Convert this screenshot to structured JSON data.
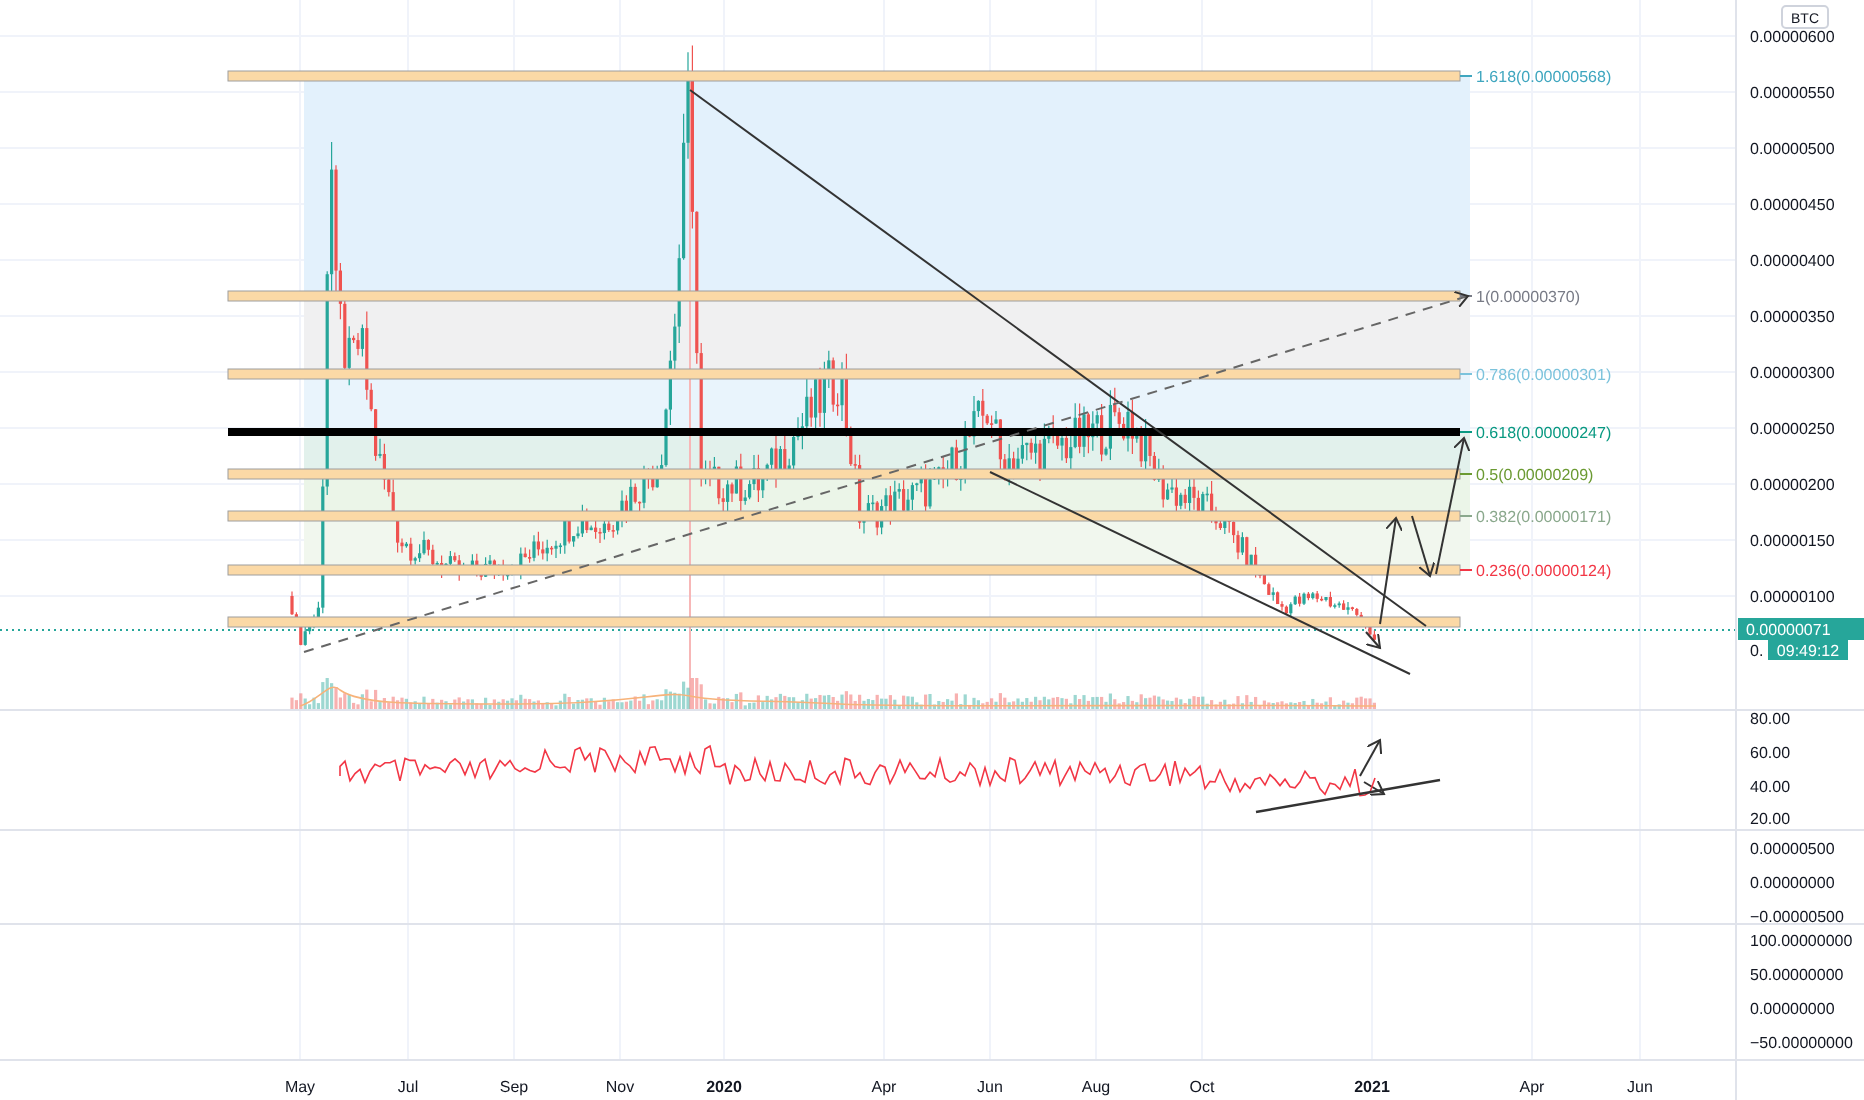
{
  "price_axis": {
    "unit": "BTC",
    "ticks": [
      "0.00000600",
      "0.00000550",
      "0.00000500",
      "0.00000450",
      "0.00000400",
      "0.00000350",
      "0.00000300",
      "0.00000250",
      "0.00000200",
      "0.00000150",
      "0.00000100",
      "0."
    ]
  },
  "last_price": {
    "value": "0.00000071",
    "countdown": "09:49:12"
  },
  "fib_levels": [
    {
      "label": "1.618(0.00000568)",
      "color": "#3fa6bf"
    },
    {
      "label": "1(0.00000370)",
      "color": "#787b86"
    },
    {
      "label": "0.786(0.00000301)",
      "color": "#7cc3dc"
    },
    {
      "label": "0.618(0.00000247)",
      "color": "#089981"
    },
    {
      "label": "0.5(0.00000209)",
      "color": "#6b9a32"
    },
    {
      "label": "0.382(0.00000171)",
      "color": "#8aa88c"
    },
    {
      "label": "0.236(0.00000124)",
      "color": "#f23645"
    }
  ],
  "rsi_axis": {
    "ticks": [
      "80.00",
      "60.00",
      "40.00",
      "20.00"
    ]
  },
  "pane_3_axis": {
    "ticks": [
      "0.00000500",
      "0.00000000",
      "−0.00000500"
    ]
  },
  "pane_4_axis": {
    "ticks": [
      "100.00000000",
      "50.00000000",
      "0.00000000",
      "−50.00000000"
    ]
  },
  "time_axis": [
    {
      "label": "May",
      "kind": "month"
    },
    {
      "label": "Jul",
      "kind": "month"
    },
    {
      "label": "Sep",
      "kind": "month"
    },
    {
      "label": "Nov",
      "kind": "month"
    },
    {
      "label": "2020",
      "kind": "year"
    },
    {
      "label": "Apr",
      "kind": "month"
    },
    {
      "label": "Jun",
      "kind": "month"
    },
    {
      "label": "Aug",
      "kind": "month"
    },
    {
      "label": "Oct",
      "kind": "month"
    },
    {
      "label": "2021",
      "kind": "year"
    },
    {
      "label": "Apr",
      "kind": "month"
    },
    {
      "label": "Jun",
      "kind": "month"
    }
  ]
}
